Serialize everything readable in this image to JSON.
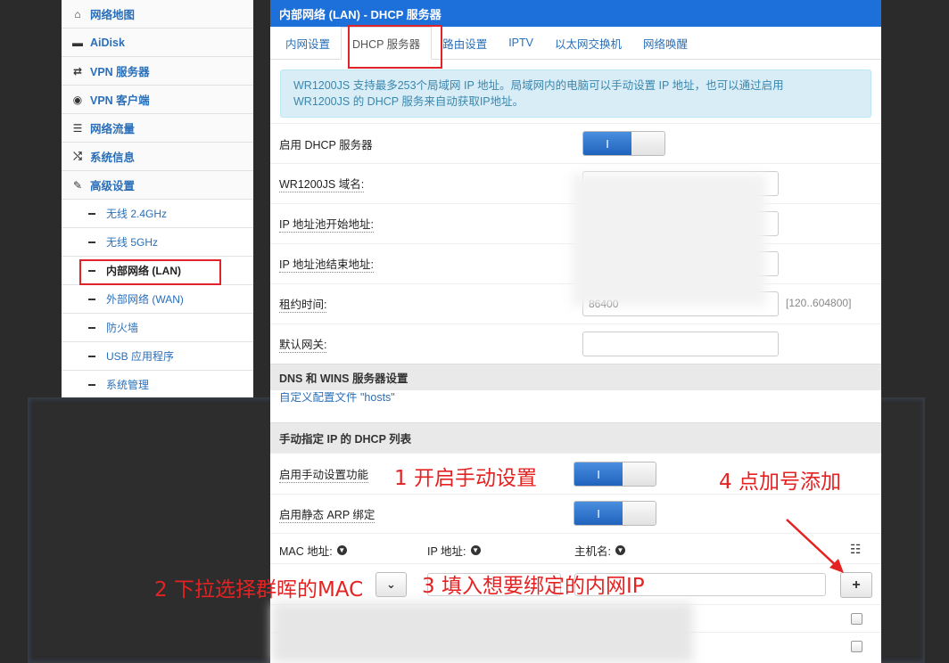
{
  "sidebar": {
    "menu": [
      {
        "icon": "home-icon",
        "glyph": "⌂",
        "label": "网络地图"
      },
      {
        "icon": "disk-icon",
        "glyph": "▬",
        "label": "AiDisk"
      },
      {
        "icon": "vpn-server-icon",
        "glyph": "⇄",
        "label": "VPN 服务器"
      },
      {
        "icon": "globe-icon",
        "glyph": "◉",
        "label": "VPN 客户端"
      },
      {
        "icon": "traffic-icon",
        "glyph": "☰",
        "label": "网络流量"
      },
      {
        "icon": "shuffle-icon",
        "glyph": "⤭",
        "label": "系统信息"
      },
      {
        "icon": "wrench-icon",
        "glyph": "✎",
        "label": "高级设置"
      }
    ],
    "sub": [
      {
        "label": "无线 2.4GHz"
      },
      {
        "label": "无线 5GHz"
      },
      {
        "label": "内部网络 (LAN)"
      },
      {
        "label": "外部网络 (WAN)"
      },
      {
        "label": "防火墙"
      },
      {
        "label": "USB 应用程序"
      },
      {
        "label": "系统管理"
      }
    ]
  },
  "main": {
    "title": "内部网络 (LAN) - DHCP 服务器",
    "tabs": [
      "内网设置",
      "DHCP 服务器",
      "路由设置",
      "IPTV",
      "以太网交换机",
      "网络唤醒"
    ],
    "alert_line1": "WR1200JS 支持最多253个局域网 IP 地址。局域网内的电脑可以手动设置 IP 地址，也可以通过启用",
    "alert_line2": "WR1200JS 的 DHCP 服务来自动获取IP地址。",
    "fields": {
      "enable_dhcp": "启用 DHCP 服务器",
      "domain": "WR1200JS 域名:",
      "pool_start": "IP 地址池开始地址:",
      "pool_end": "IP 地址池结束地址:",
      "lease": "租约时间:",
      "lease_value": "86400",
      "lease_hint": "[120..604800]",
      "gateway": "默认网关:"
    },
    "toggle_on_symbol": "I",
    "section_dns": "DNS 和 WINS 服务器设置",
    "hosts_link": "自定义配置文件 \"hosts\"",
    "section_manual": "手动指定 IP 的 DHCP 列表",
    "enable_manual": "启用手动设置功能",
    "enable_arp": "启用静态 ARP 绑定",
    "col_mac": "MAC 地址:",
    "col_ip": "IP 地址:",
    "col_host": "主机名:",
    "add_button": "+",
    "dropdown_caret": "⌄"
  },
  "annotations": {
    "a1": "1 开启手动设置",
    "a2": "2 下拉选择群晖的MAC",
    "a3": "3 填入想要绑定的内网IP",
    "a4": "4 点加号添加"
  }
}
